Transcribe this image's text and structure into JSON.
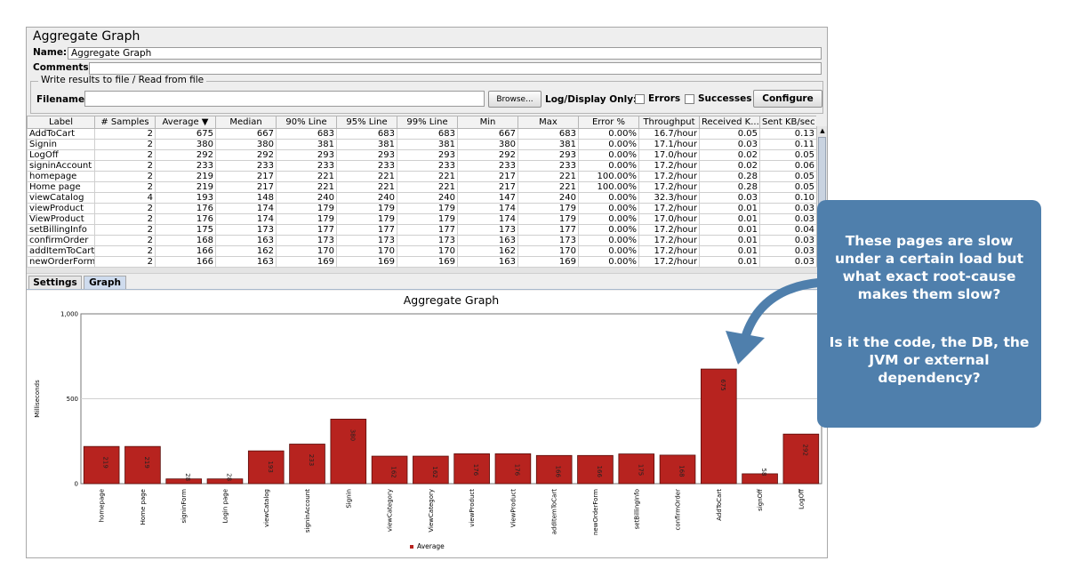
{
  "panel": {
    "title": "Aggregate Graph",
    "name_label": "Name:",
    "name_value": "Aggregate Graph",
    "comments_label": "Comments:",
    "comments_value": ""
  },
  "file_section": {
    "title": "Write results to file / Read from file",
    "filename_label": "Filename",
    "filename_value": "",
    "browse_label": "Browse...",
    "log_display_label": "Log/Display Only:",
    "errors_label": "Errors",
    "successes_label": "Successes",
    "configure_label": "Configure"
  },
  "table": {
    "columns": [
      "Label",
      "# Samples",
      "Average ▼",
      "Median",
      "90% Line",
      "95% Line",
      "99% Line",
      "Min",
      "Max",
      "Error %",
      "Throughput",
      "Received K...",
      "Sent KB/sec"
    ],
    "rows": [
      [
        "AddToCart",
        "2",
        "675",
        "667",
        "683",
        "683",
        "683",
        "667",
        "683",
        "0.00%",
        "16.7/hour",
        "0.05",
        "0.13"
      ],
      [
        "Signin",
        "2",
        "380",
        "380",
        "381",
        "381",
        "381",
        "380",
        "381",
        "0.00%",
        "17.1/hour",
        "0.03",
        "0.11"
      ],
      [
        "LogOff",
        "2",
        "292",
        "292",
        "293",
        "293",
        "293",
        "292",
        "293",
        "0.00%",
        "17.0/hour",
        "0.02",
        "0.05"
      ],
      [
        "signinAccount",
        "2",
        "233",
        "233",
        "233",
        "233",
        "233",
        "233",
        "233",
        "0.00%",
        "17.2/hour",
        "0.02",
        "0.06"
      ],
      [
        "homepage",
        "2",
        "219",
        "217",
        "221",
        "221",
        "221",
        "217",
        "221",
        "100.00%",
        "17.2/hour",
        "0.28",
        "0.05"
      ],
      [
        "Home page",
        "2",
        "219",
        "217",
        "221",
        "221",
        "221",
        "217",
        "221",
        "100.00%",
        "17.2/hour",
        "0.28",
        "0.05"
      ],
      [
        "viewCatalog",
        "4",
        "193",
        "148",
        "240",
        "240",
        "240",
        "147",
        "240",
        "0.00%",
        "32.3/hour",
        "0.03",
        "0.10"
      ],
      [
        "viewProduct",
        "2",
        "176",
        "174",
        "179",
        "179",
        "179",
        "174",
        "179",
        "0.00%",
        "17.2/hour",
        "0.01",
        "0.03"
      ],
      [
        "ViewProduct",
        "2",
        "176",
        "174",
        "179",
        "179",
        "179",
        "174",
        "179",
        "0.00%",
        "17.0/hour",
        "0.01",
        "0.03"
      ],
      [
        "setBillingInfo",
        "2",
        "175",
        "173",
        "177",
        "177",
        "177",
        "173",
        "177",
        "0.00%",
        "17.2/hour",
        "0.01",
        "0.04"
      ],
      [
        "confirmOrder",
        "2",
        "168",
        "163",
        "173",
        "173",
        "173",
        "163",
        "173",
        "0.00%",
        "17.2/hour",
        "0.01",
        "0.03"
      ],
      [
        "addItemToCart",
        "2",
        "166",
        "162",
        "170",
        "170",
        "170",
        "162",
        "170",
        "0.00%",
        "17.2/hour",
        "0.01",
        "0.03"
      ],
      [
        "newOrderForm",
        "2",
        "166",
        "163",
        "169",
        "169",
        "169",
        "163",
        "169",
        "0.00%",
        "17.2/hour",
        "0.01",
        "0.03"
      ]
    ]
  },
  "tabs": [
    {
      "label": "Settings",
      "active": false
    },
    {
      "label": "Graph",
      "active": true
    }
  ],
  "chart_data": {
    "type": "bar",
    "title": "Aggregate Graph",
    "xlabel": "",
    "ylabel": "Milliseconds",
    "ylim": [
      0,
      1000
    ],
    "yticks": [
      "0",
      "500",
      "1,000"
    ],
    "grid": true,
    "legend_position": "bottom",
    "bar_color": "#b7231f",
    "categories": [
      "homepage",
      "Home page",
      "signinForm",
      "Login page",
      "viewCatalog",
      "signinAccount",
      "Signin",
      "viewCategory",
      "ViewCategory",
      "viewProduct",
      "ViewProduct",
      "addItemToCart",
      "newOrderForm",
      "setBillingInfo",
      "confirmOrder",
      "AddToCart",
      "signOff",
      "LogOff"
    ],
    "series": [
      {
        "name": "Average",
        "values": [
          219,
          219,
          28,
          28,
          193,
          233,
          380,
          162,
          162,
          176,
          176,
          166,
          166,
          175,
          168,
          675,
          58,
          292
        ]
      }
    ]
  },
  "callout": {
    "text_1": "These pages are slow under a certain load but what exact root-cause makes them slow?",
    "text_2": "Is it the code, the DB, the JVM or external dependency?",
    "color": "#4f7fac"
  }
}
